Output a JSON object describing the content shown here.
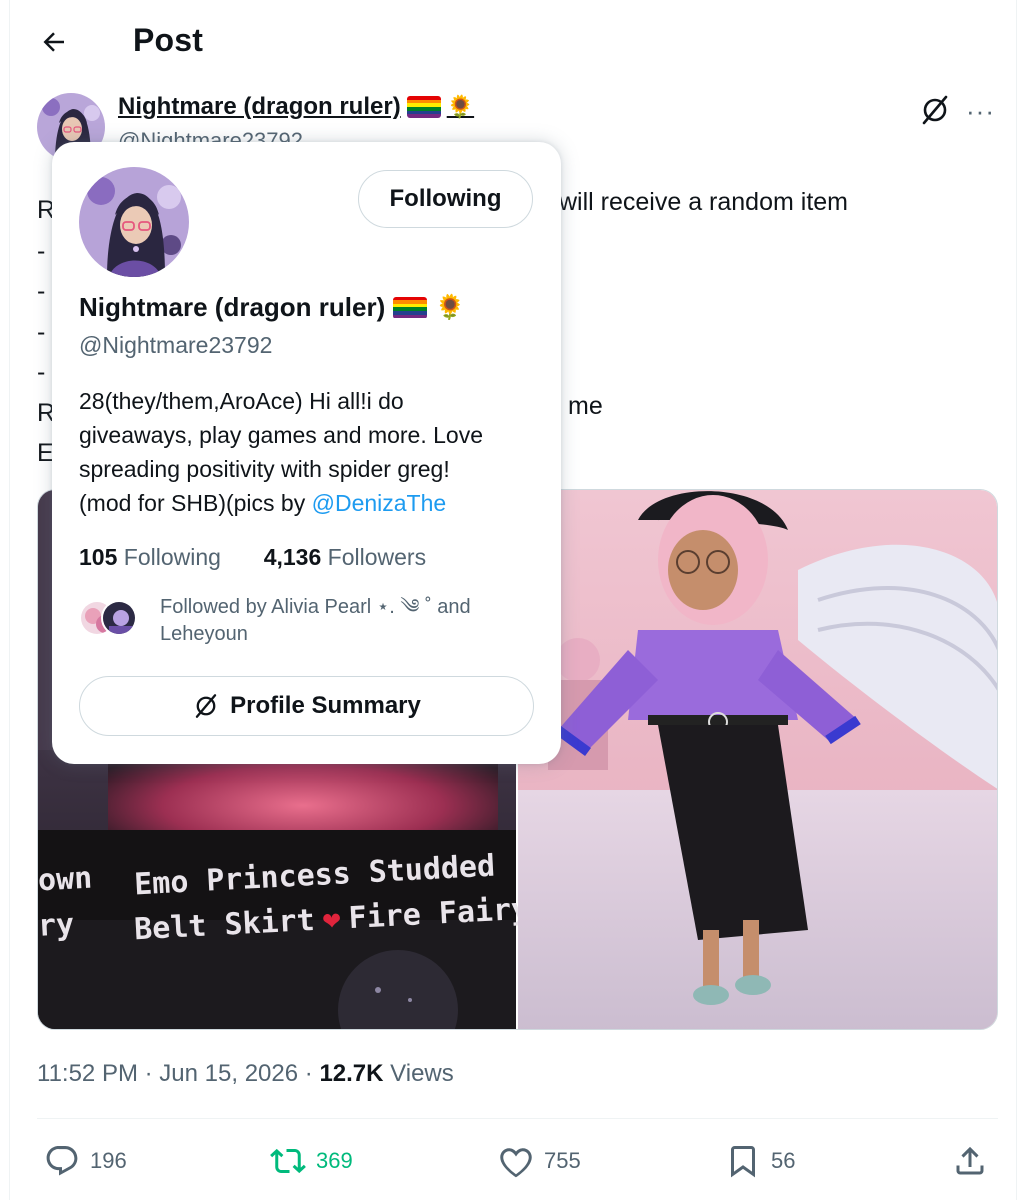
{
  "header": {
    "title": "Post"
  },
  "author": {
    "name": "Nightmare (dragon ruler)",
    "handle_partial": "@Nightmare23792",
    "emoji": "🏳️‍🌈🌻"
  },
  "tweet": {
    "left_chars": [
      "R",
      "-",
      "-",
      "-",
      "-",
      "R",
      "E"
    ],
    "visible_right_1": "will receive a random item",
    "visible_right_2": "me"
  },
  "media": {
    "left_caption_1": "Emo Princess Studded",
    "left_caption_2": "Belt Skirt",
    "left_caption_3": "Fire Fairy",
    "left_edge_1": "own",
    "left_edge_2": "ry"
  },
  "meta": {
    "time": "11:52 PM",
    "date": "Jun 15, 2026",
    "views_count": "12.7K",
    "views_label": "Views"
  },
  "actions": {
    "replies": "196",
    "reposts": "369",
    "likes": "755",
    "bookmarks": "56"
  },
  "hover_card": {
    "following_label": "Following",
    "name": "Nightmare (dragon ruler)",
    "handle": "@Nightmare23792",
    "bio_lines": [
      "28(they/them,AroAce) Hi all!i do",
      "giveaways, play games and more.  Love",
      "spreading positivity with spider greg!",
      "(mod for SHB)(pics by "
    ],
    "bio_mention": "@DenizaThe",
    "following_count": "105",
    "following_label_text": "Following",
    "followers_count": "4,136",
    "followers_label_text": "Followers",
    "followed_by_line1": "Followed by Alivia Pearl ⋆. ༄ ˚ and",
    "followed_by_line2": "Leheyoun",
    "summary_label": "Profile Summary"
  },
  "colors": {
    "text_primary": "#0f1419",
    "text_secondary": "#536471",
    "link": "#1d9bf0",
    "repost_green": "#00ba7c",
    "border": "#cfd9de"
  },
  "icons": [
    "back-arrow-icon",
    "grok-icon",
    "more-icon",
    "reply-icon",
    "repost-icon",
    "like-icon",
    "bookmark-icon",
    "share-icon"
  ]
}
